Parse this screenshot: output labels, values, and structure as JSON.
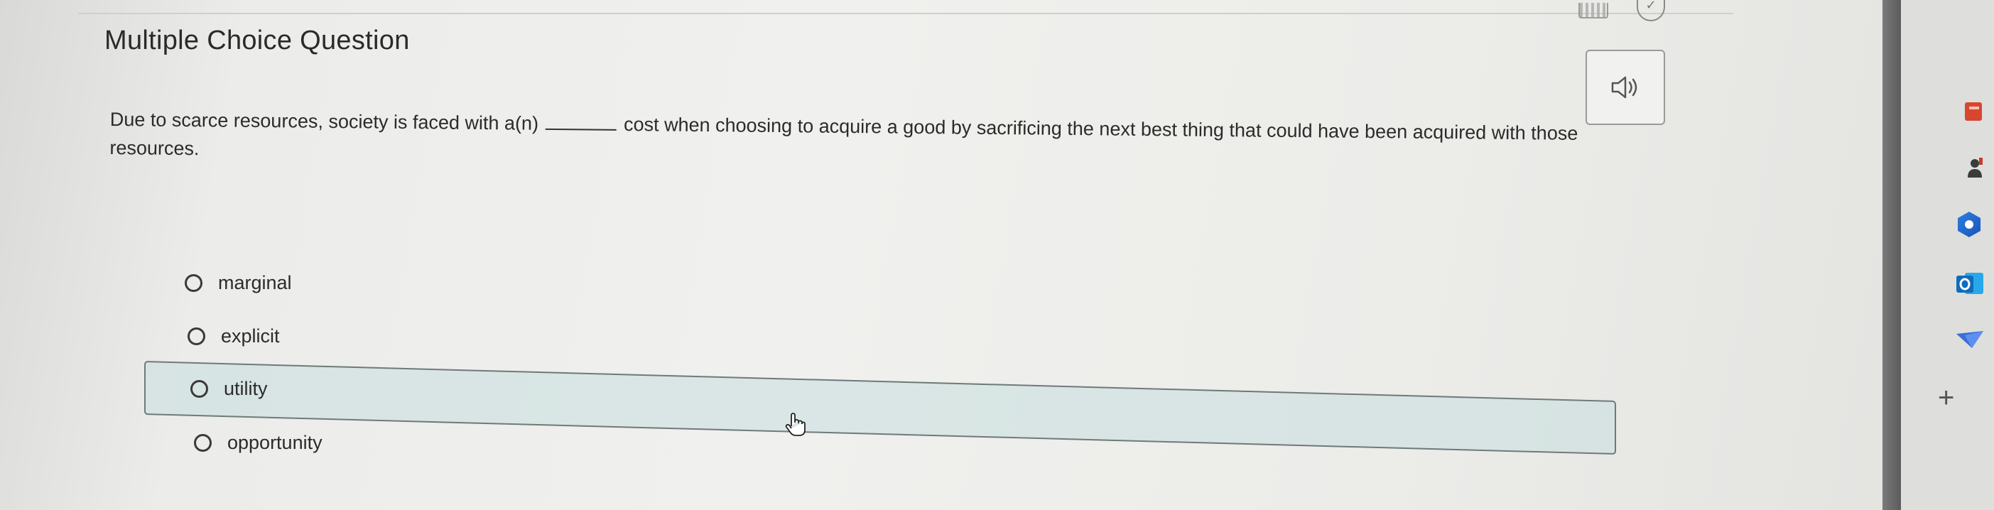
{
  "question": {
    "title": "Multiple Choice Question",
    "stem_before_blank": "Due to scarce resources, society is faced with a(n)",
    "stem_after_blank": "cost when choosing to acquire a good by sacrificing the next best thing that could have been acquired with those resources."
  },
  "options": [
    {
      "label": "marginal"
    },
    {
      "label": "explicit"
    },
    {
      "label": "utility"
    },
    {
      "label": "opportunity"
    }
  ],
  "toolbar": {
    "icons": [
      "calculator-icon",
      "check-icon",
      "speaker-icon"
    ]
  },
  "sidebar": {
    "icons": [
      "app-icon-red",
      "app-icon-person",
      "copilot-icon",
      "outlook-icon",
      "send-icon",
      "plus-icon"
    ]
  },
  "colors": {
    "text": "#2b2b2b",
    "highlight_fill": "#cde1e0",
    "highlight_border": "#6e7a7a",
    "outlook_blue": "#0f6cbd"
  }
}
